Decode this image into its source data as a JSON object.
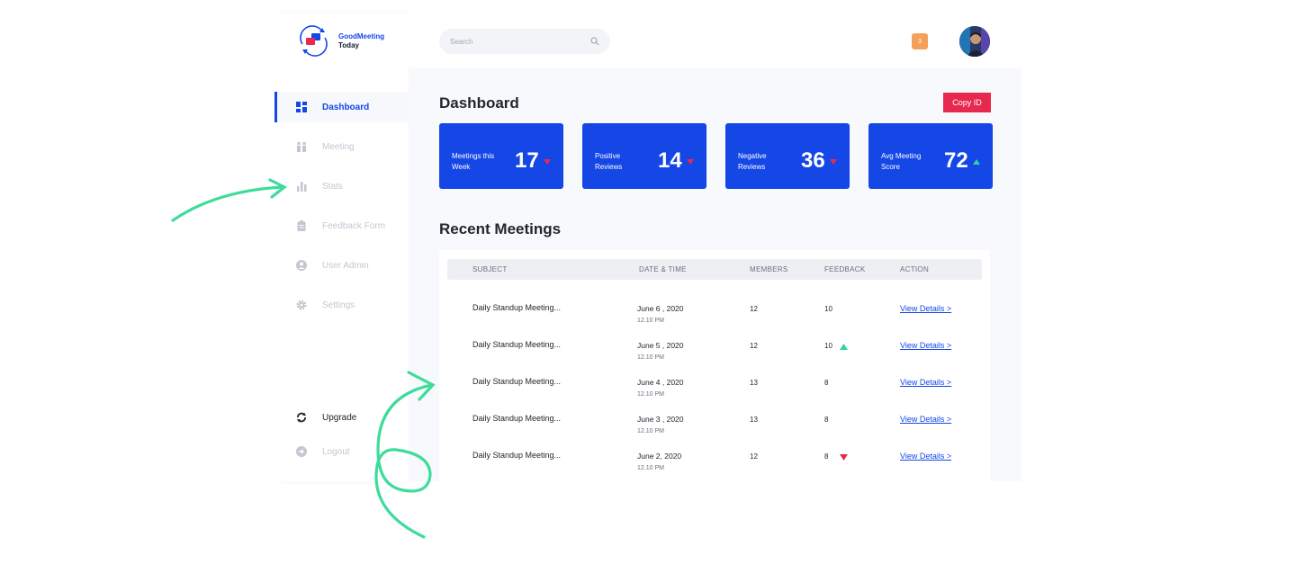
{
  "app": {
    "logo_line1": "GoodMeeting",
    "logo_line2": "Today",
    "brand_color": "#1447e6"
  },
  "sidebar": {
    "items": [
      {
        "label": "Dashboard",
        "icon": "grid-icon",
        "active": true
      },
      {
        "label": "Meeting",
        "icon": "people-icon"
      },
      {
        "label": "Stats",
        "icon": "bar-chart-icon"
      },
      {
        "label": "Feedback Form",
        "icon": "clipboard-icon"
      },
      {
        "label": "User Admin",
        "icon": "user-icon"
      },
      {
        "label": "Settings",
        "icon": "gear-icon"
      }
    ],
    "bottom": [
      {
        "label": "Upgrade",
        "icon": "refresh-icon"
      },
      {
        "label": "Logout",
        "icon": "logout-icon"
      }
    ]
  },
  "header": {
    "search_placeholder": "Search",
    "notification_count": "3",
    "notification_color": "#f5a05a"
  },
  "dashboard": {
    "title": "Dashboard",
    "copy_button": "Copy ID",
    "copy_button_color": "#e8294f",
    "cards": [
      {
        "label": "Meetings this Week",
        "value": "17",
        "trend": "down"
      },
      {
        "label": "Positive Reviews",
        "value": "14",
        "trend": "down"
      },
      {
        "label": "Negative Reviews",
        "value": "36",
        "trend": "down"
      },
      {
        "label": "Avg Meeting Score",
        "value": "72",
        "trend": "up"
      }
    ]
  },
  "meetings": {
    "title": "Recent Meetings",
    "columns": [
      "SUBJECT",
      "DATE & TIME",
      "MEMBERS",
      "FEEDBACK",
      "ACTION"
    ],
    "rows": [
      {
        "subject": "Daily Standup Meeting...",
        "date": "June 6 , 2020",
        "time": "12.10 PM",
        "members": "12",
        "feedback": "10",
        "trend": "",
        "action": "View Details >"
      },
      {
        "subject": "Daily Standup Meeting...",
        "date": "June 5 , 2020",
        "time": "12.10 PM",
        "members": "12",
        "feedback": "10",
        "trend": "up",
        "action": "View Details >"
      },
      {
        "subject": "Daily Standup Meeting...",
        "date": "June 4 , 2020",
        "time": "12.10 PM",
        "members": "13",
        "feedback": "8",
        "trend": "",
        "action": "View Details >"
      },
      {
        "subject": "Daily Standup Meeting...",
        "date": "June 3 , 2020",
        "time": "12.10 PM",
        "members": "13",
        "feedback": "8",
        "trend": "",
        "action": "View Details >"
      },
      {
        "subject": "Daily Standup Meeting...",
        "date": "June 2, 2020",
        "time": "12.10 PM",
        "members": "12",
        "feedback": "8",
        "trend": "down",
        "action": "View Details >"
      }
    ]
  },
  "colors": {
    "up": "#2ed5a2",
    "down": "#e8294f",
    "annotation_arrow": "#3ddc9a"
  }
}
